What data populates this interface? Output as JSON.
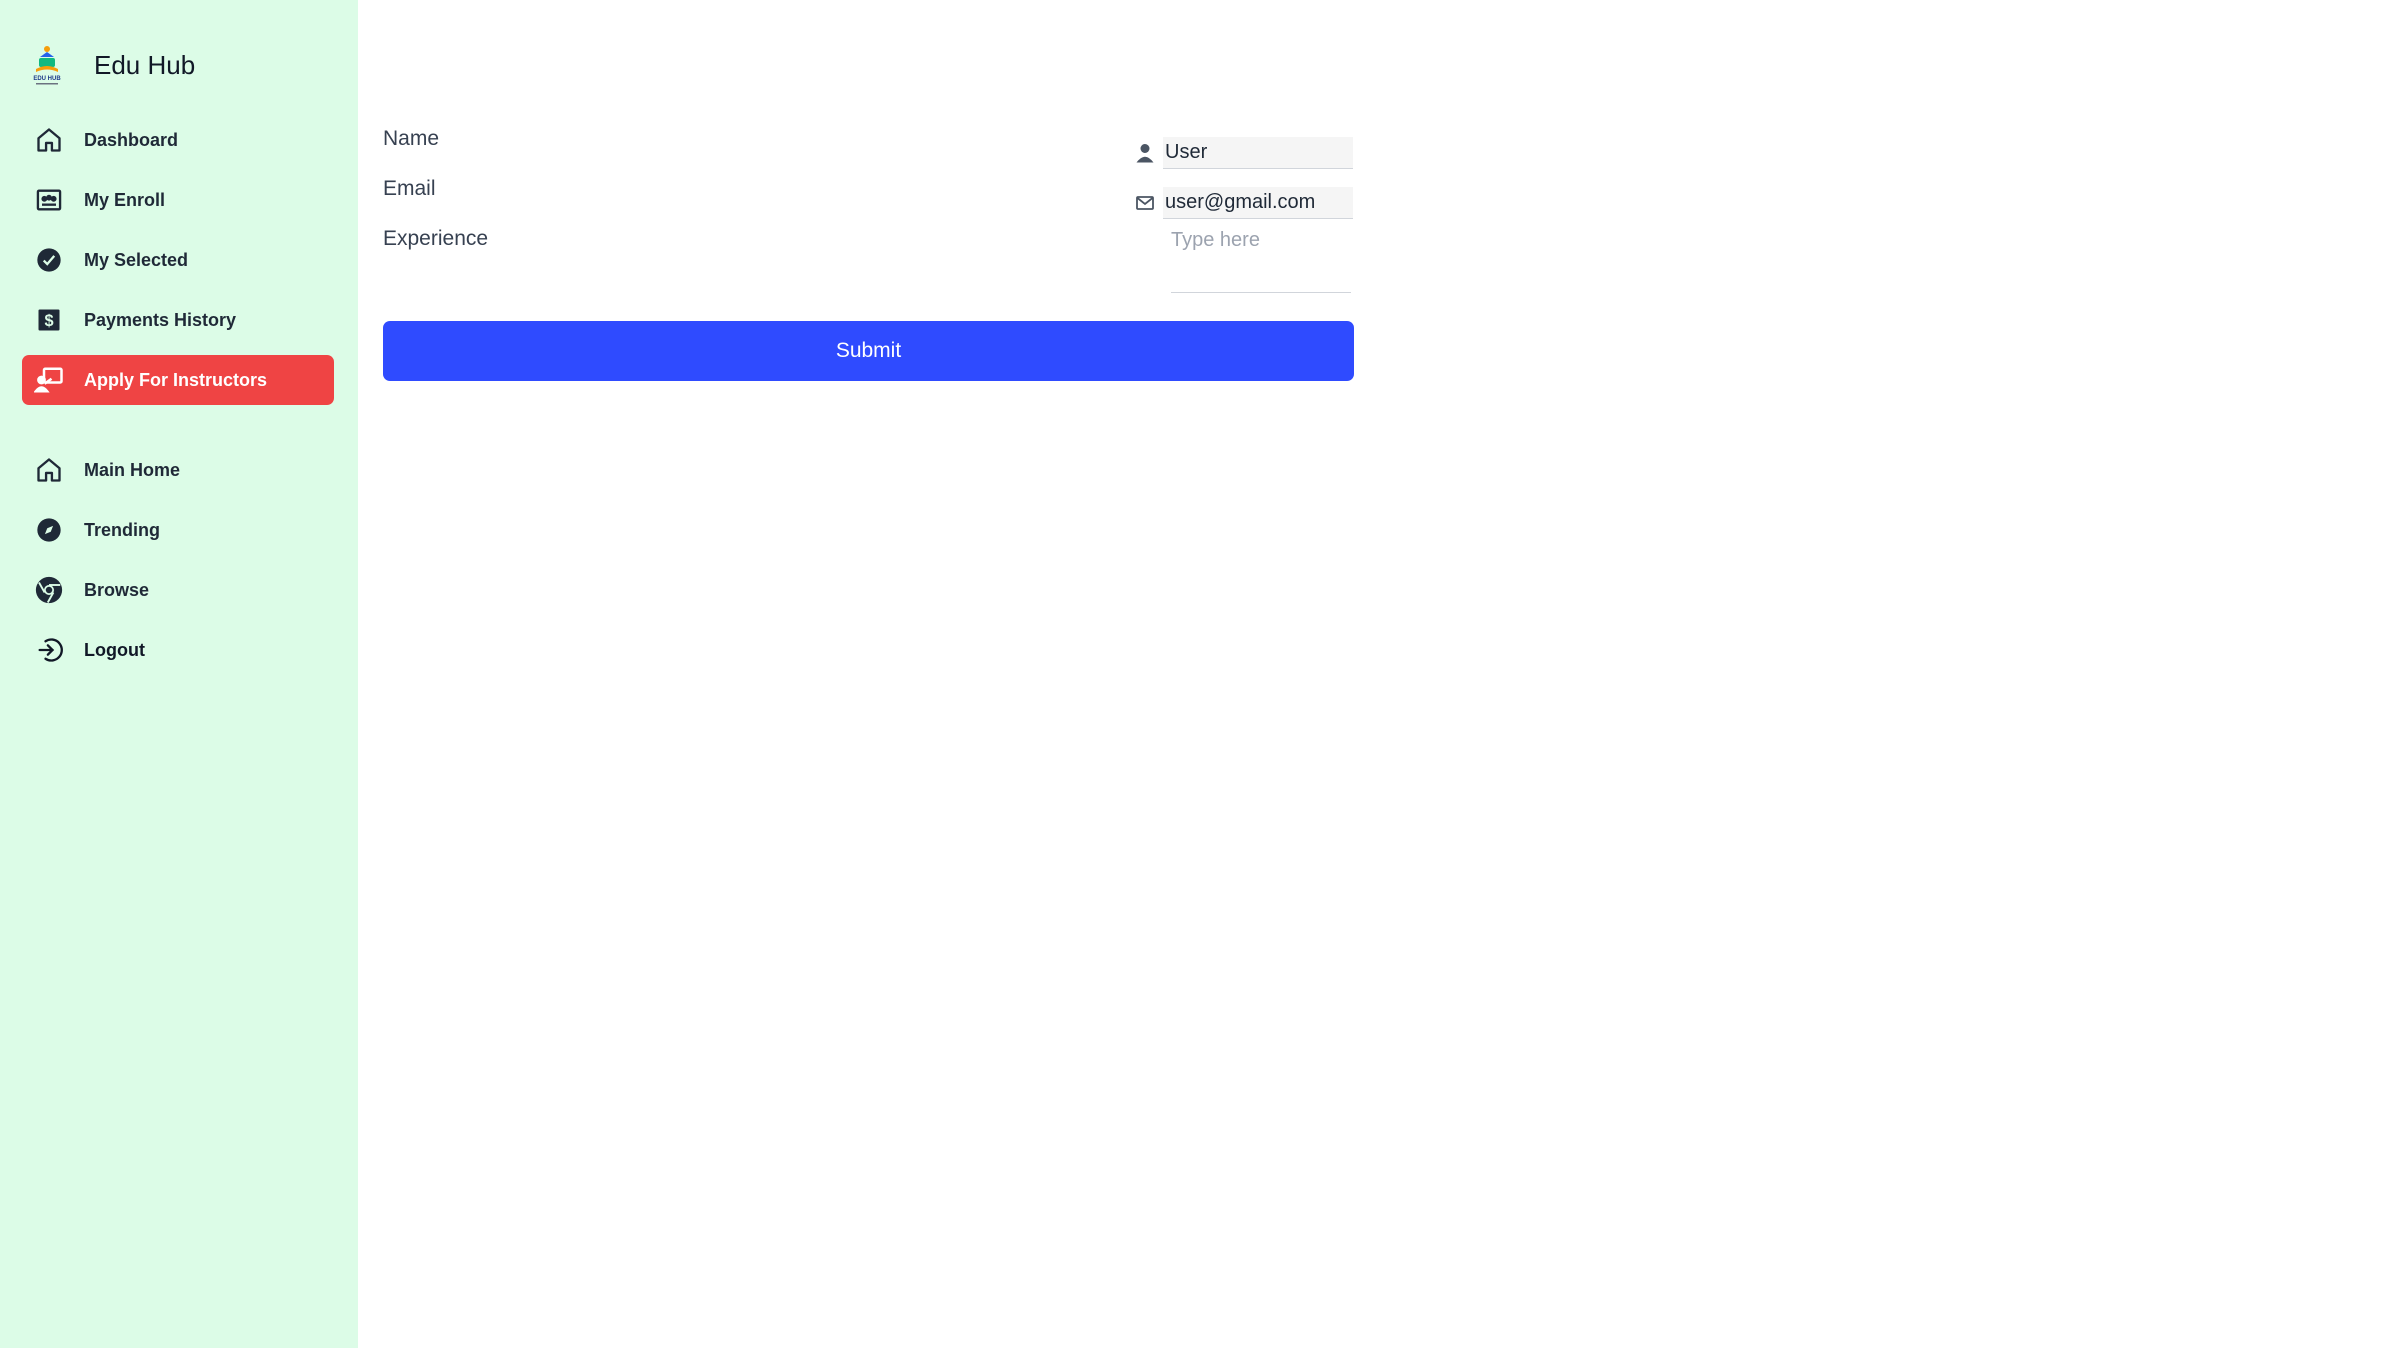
{
  "brand": {
    "name": "Edu Hub",
    "logo_text": "EDU HUB"
  },
  "sidebar": {
    "top_items": [
      {
        "label": "Dashboard",
        "icon": "home-icon"
      },
      {
        "label": "My Enroll",
        "icon": "enroll-icon"
      },
      {
        "label": "My Selected",
        "icon": "check-circle-icon"
      },
      {
        "label": "Payments History",
        "icon": "dollar-bill-icon"
      },
      {
        "label": "Apply For Instructors",
        "icon": "instructor-icon",
        "active": true
      }
    ],
    "bottom_items": [
      {
        "label": "Main Home",
        "icon": "home-icon"
      },
      {
        "label": "Trending",
        "icon": "compass-icon"
      },
      {
        "label": "Browse",
        "icon": "chrome-icon"
      },
      {
        "label": "Logout",
        "icon": "logout-icon"
      }
    ]
  },
  "form": {
    "name_label": "Name",
    "name_value": "User",
    "email_label": "Email",
    "email_value": "user@gmail.com",
    "experience_label": "Experience",
    "experience_placeholder": "Type here",
    "submit_label": "Submit"
  },
  "colors": {
    "sidebar_bg": "#dcfce7",
    "active_bg": "#ef4444",
    "submit_bg": "#2f4bff"
  }
}
